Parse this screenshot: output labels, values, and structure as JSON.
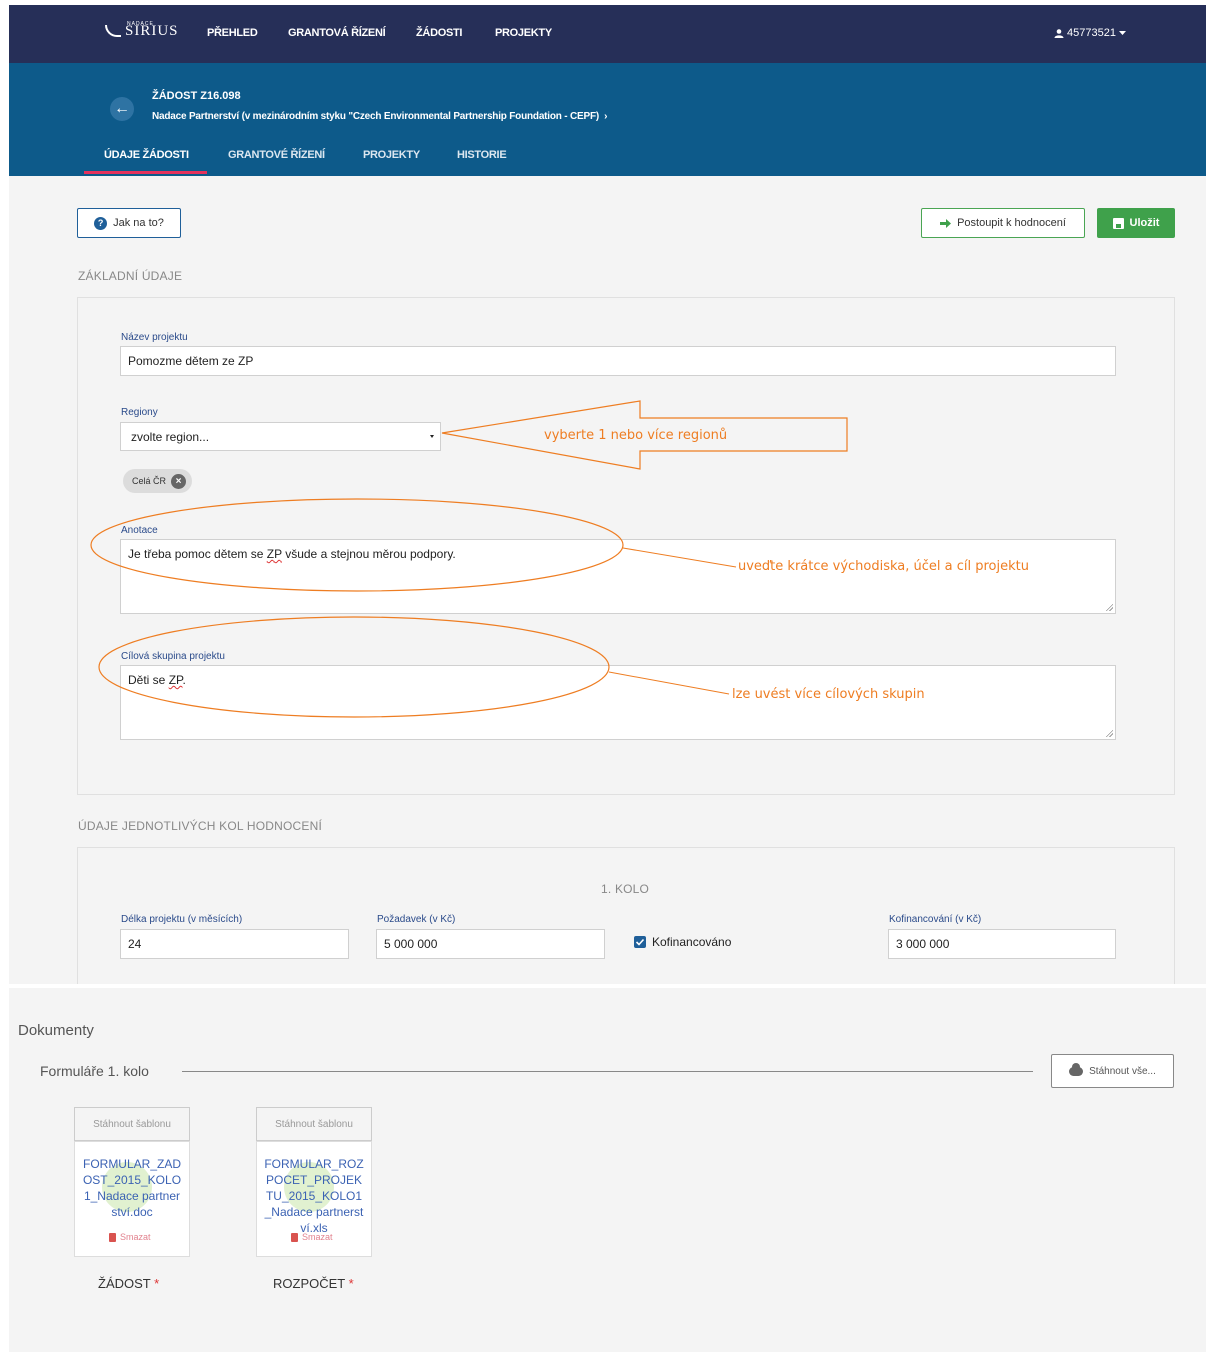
{
  "app": {
    "logo_small": "NADACE",
    "logo_big": "SIRIUS",
    "nav": [
      "PŘEHLED",
      "GRANTOVÁ ŘÍZENÍ",
      "ŽÁDOSTI",
      "PROJEKTY"
    ],
    "user": "45773521"
  },
  "request": {
    "id_label": "ŽÁDOST Z16.098",
    "organization": "Nadace Partnerství (v mezinárodním styku \"Czech Environmental Partnership Foundation - CEPF)",
    "tabs": [
      "ÚDAJE ŽÁDOSTI",
      "GRANTOVÉ ŘÍZENÍ",
      "PROJEKTY",
      "HISTORIE"
    ]
  },
  "toolbar": {
    "help": "Jak na to?",
    "advance": "Postoupit k hodnocení",
    "save": "Uložit"
  },
  "basic": {
    "section_title": "ZÁKLADNÍ ÚDAJE",
    "project_name_label": "Název projektu",
    "project_name_value": "Pomozme dětem ze ZP",
    "regions_label": "Regiony",
    "regions_placeholder": "zvolte region...",
    "region_chip": "Celá ČR",
    "annotation_label": "Anotace",
    "annotation_value_pre": "Je třeba pomoc dětem se ",
    "annotation_value_mark": "ZP",
    "annotation_value_post": " všude a stejnou měrou podpory.",
    "target_label": "Cílová skupina projektu",
    "target_value_pre": "Děti se ",
    "target_value_mark": "ZP",
    "target_value_post": "."
  },
  "annotations": {
    "regions_hint": "vyberte   1 nebo více regionů",
    "annotation_hint": "uveďte krátce východiska, účel a cíl projektu",
    "target_hint": "lze uvést více cílových skupin"
  },
  "rounds": {
    "section_title": "ÚDAJE JEDNOTLIVÝCH KOL HODNOCENÍ",
    "round_title": "1. KOLO",
    "duration_label": "Délka projektu (v měsících)",
    "duration_value": "24",
    "request_label": "Požadavek (v Kč)",
    "request_value": "5 000 000",
    "cofinanced_label": "Kofinancováno",
    "cofinanced_checked": true,
    "cofinancing_label": "Kofinancování (v Kč)",
    "cofinancing_value": "3 000 000"
  },
  "documents": {
    "title": "Dokumenty",
    "forms_title": "Formuláře 1. kolo",
    "download_all": "Stáhnout vše...",
    "items": [
      {
        "template_button": "Stáhnout šablonu",
        "filename": "FORMULAR_ZADOST_2015_KOLO1_Nadace partnerství.doc",
        "delete": "Smazat",
        "caption": "ŽÁDOST",
        "required_mark": "*"
      },
      {
        "template_button": "Stáhnout šablonu",
        "filename": "FORMULAR_ROZPOCET_PROJEKTU_2015_KOLO1_Nadace partnerství.xls",
        "delete": "Smazat",
        "caption": "ROZPOČET",
        "required_mark": "*"
      }
    ]
  },
  "colors": {
    "navbar": "#262f58",
    "header": "#0d5a8a",
    "tab_underline": "#e5325c",
    "save_green": "#3fa14b",
    "annotation_orange": "#ee7d22"
  }
}
